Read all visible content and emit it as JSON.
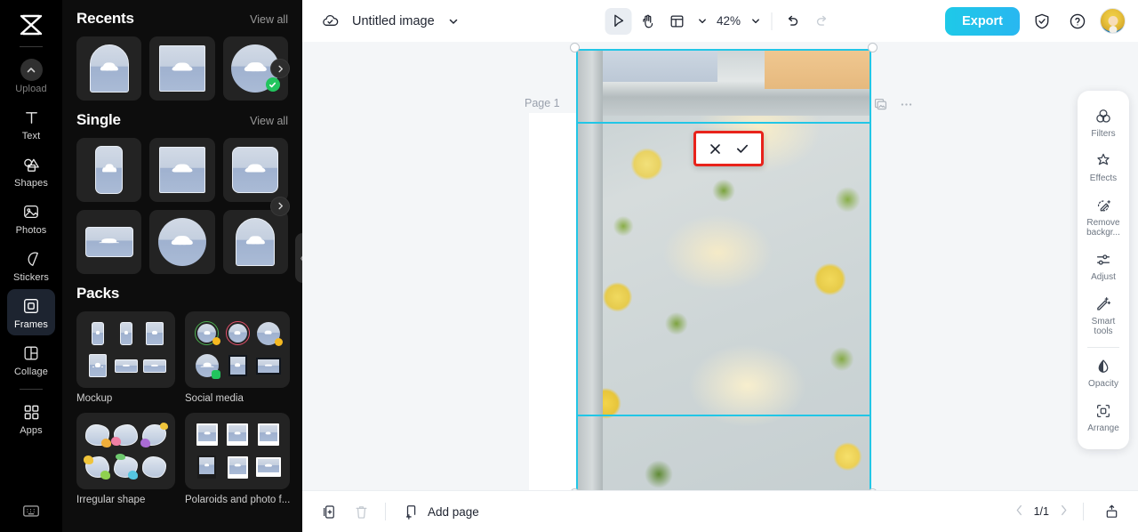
{
  "app": {
    "logo_icon": "capcut-logo-icon"
  },
  "rail": {
    "items": [
      {
        "label": "Upload",
        "icon": "upload-chevron-icon",
        "active": false,
        "dim": true
      },
      {
        "label": "Text",
        "icon": "text-t-icon",
        "active": false,
        "dim": false
      },
      {
        "label": "Shapes",
        "icon": "shapes-icon",
        "active": false,
        "dim": false
      },
      {
        "label": "Photos",
        "icon": "photos-image-icon",
        "active": false,
        "dim": false
      },
      {
        "label": "Stickers",
        "icon": "sticker-icon",
        "active": false,
        "dim": false
      },
      {
        "label": "Frames",
        "icon": "frames-icon",
        "active": true,
        "dim": false
      },
      {
        "label": "Collage",
        "icon": "collage-icon",
        "active": false,
        "dim": false
      },
      {
        "label": "Apps",
        "icon": "apps-grid-icon",
        "active": false,
        "dim": false
      }
    ],
    "bottom_icon": "keyboard-shortcuts-icon"
  },
  "panel": {
    "sections": [
      {
        "title": "Recents",
        "view_all": "View all"
      },
      {
        "title": "Single",
        "view_all": "View all"
      },
      {
        "title": "Packs"
      }
    ],
    "packs": [
      {
        "label": "Mockup"
      },
      {
        "label": "Social media"
      },
      {
        "label": "Irregular shape"
      },
      {
        "label": "Polaroids and photo f..."
      }
    ],
    "collapse_icon": "chevron-left-icon"
  },
  "topbar": {
    "cloud_icon": "cloud-saved-icon",
    "title": "Untitled image",
    "title_chevron": "chevron-down-icon",
    "select_tool_icon": "cursor-select-icon",
    "hand_tool_icon": "hand-pan-icon",
    "layout_tool_icon": "layout-grid-icon",
    "layout_chevron": "chevron-down-icon",
    "zoom_value": "42%",
    "zoom_chevron": "chevron-down-icon",
    "undo_icon": "undo-arrow-icon",
    "redo_icon": "redo-arrow-icon",
    "export_label": "Export",
    "shield_icon": "shield-check-icon",
    "help_icon": "question-circle-icon",
    "avatar_icon": "user-avatar"
  },
  "canvas": {
    "page_label": "Page 1",
    "duplicate_icon": "duplicate-layer-icon",
    "more_icon": "more-horizontal-icon",
    "crop": {
      "cancel_icon": "close-x-icon",
      "confirm_icon": "check-icon",
      "border_color": "#22c6e6",
      "highlight_color": "#e8231b"
    }
  },
  "dock": {
    "items": [
      {
        "label": "Filters",
        "icon": "filters-circles-icon"
      },
      {
        "label": "Effects",
        "icon": "effects-sparkle-icon"
      },
      {
        "label": "Remove\nbackgr...",
        "icon": "remove-background-icon"
      },
      {
        "label": "Adjust",
        "icon": "adjust-sliders-icon"
      },
      {
        "label": "Smart\ntools",
        "icon": "smart-tools-wand-icon"
      },
      {
        "label": "Opacity",
        "icon": "opacity-droplet-icon"
      },
      {
        "label": "Arrange",
        "icon": "arrange-frame-icon"
      }
    ],
    "remove_bg_line1": "Remove",
    "remove_bg_line2": "backgr...",
    "smart_line1": "Smart",
    "smart_line2": "tools"
  },
  "bottombar": {
    "duplicate_page_icon": "duplicate-page-icon",
    "delete_page_icon": "trash-delete-icon",
    "add_page_icon": "add-page-icon",
    "add_page_label": "Add page",
    "prev_icon": "chevron-left-icon",
    "page_indicator": "1/1",
    "next_icon": "chevron-right-icon",
    "present_icon": "present-export-icon"
  }
}
